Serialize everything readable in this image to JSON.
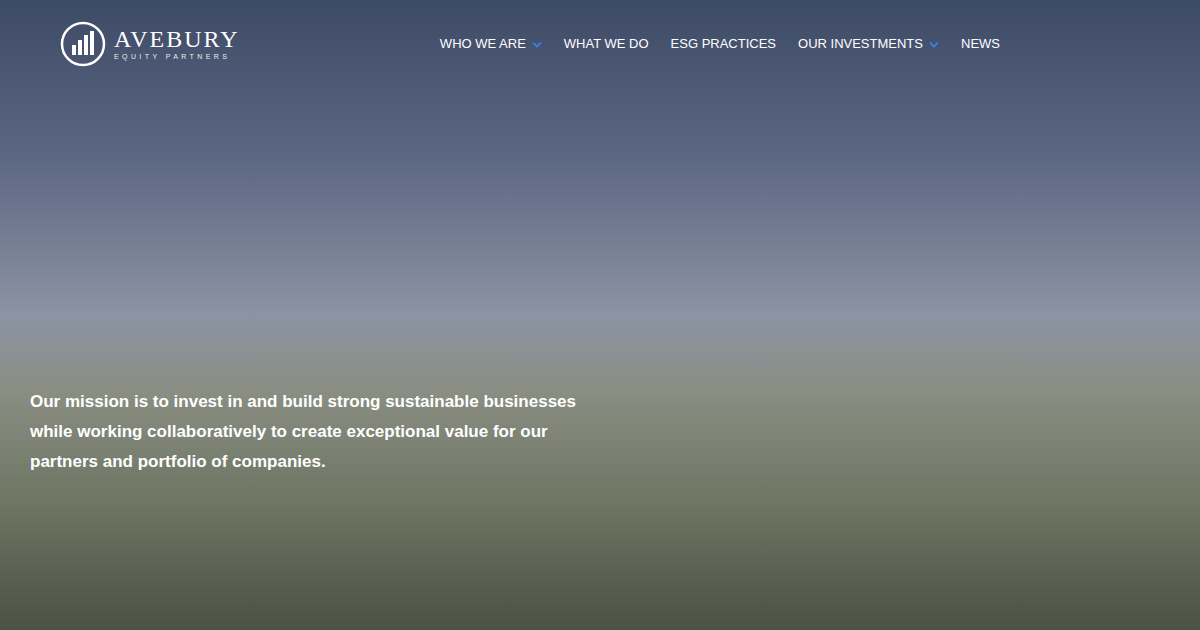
{
  "logo": {
    "name": "AVEBURY",
    "tagline": "EQUITY PARTNERS"
  },
  "nav": {
    "items": [
      {
        "label": "WHO WE ARE",
        "kind": "dropdown"
      },
      {
        "label": "WHAT WE DO",
        "kind": "link"
      },
      {
        "label": "ESG PRACTICES",
        "kind": "link"
      },
      {
        "label": "OUR INVESTMENTS",
        "kind": "dropdown"
      },
      {
        "label": "NEWS",
        "kind": "link"
      }
    ]
  },
  "hero": {
    "mission": "Our mission is to invest in and build strong sustainable businesses while working collaboratively to create exceptional value for our partners and portfolio of companies."
  }
}
